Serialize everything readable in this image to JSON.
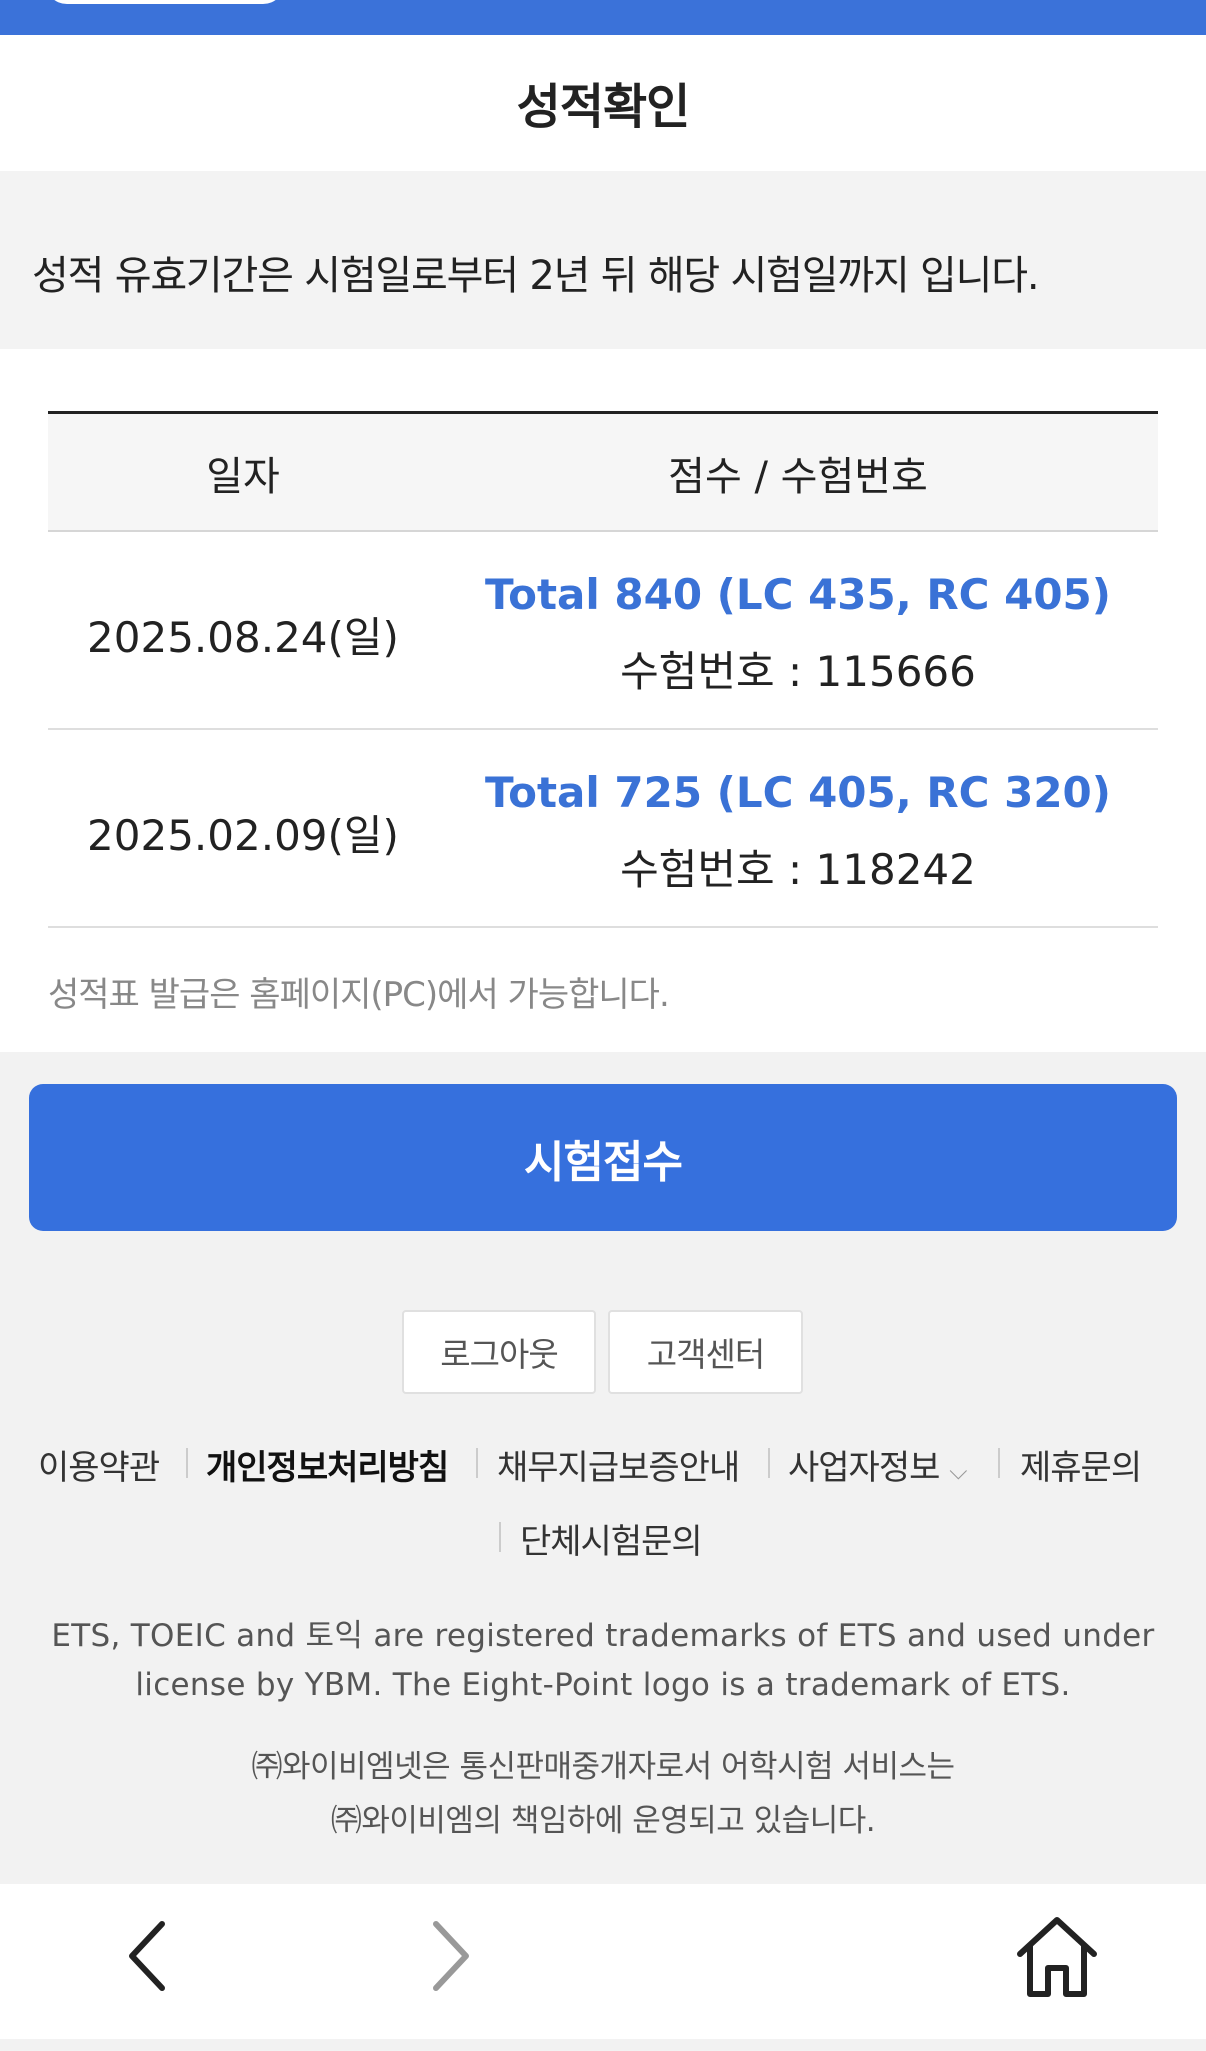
{
  "header": {
    "title": "성적확인"
  },
  "notice": "성적 유효기간은 시험일로부터 2년 뒤 해당 시험일까지 입니다.",
  "table": {
    "columns": [
      "일자",
      "점수 / 수험번호"
    ],
    "rows": [
      {
        "date": "2025.08.24(일)",
        "score": "Total 840 (LC 435, RC 405)",
        "reg": "수험번호 : 115666"
      },
      {
        "date": "2025.02.09(일)",
        "score": "Total 725 (LC 405, RC 320)",
        "reg": "수험번호 : 118242"
      }
    ]
  },
  "note": "성적표 발급은 홈페이지(PC)에서 가능합니다.",
  "apply_button": "시험접수",
  "logout_button": "로그아웃",
  "customer_center_button": "고객센터",
  "footer_links": {
    "terms": "이용약관",
    "privacy": "개인정보처리방침",
    "guarantee": "채무지급보증안내",
    "business": "사업자정보",
    "partnership": "제휴문의",
    "group_test": "단체시험문의"
  },
  "legal": {
    "trademark_line1": "ETS, TOEIC and 토익 are registered trademarks of ETS and used under",
    "trademark_line2": "license by YBM. The Eight-Point logo is a trademark of ETS.",
    "company_line1": "㈜와이비엠넷은 통신판매중개자로서 어학시험 서비스는",
    "company_line2": "㈜와이비엠의 책임하에 운영되고 있습니다."
  },
  "colors": {
    "primary": "#3670dd",
    "score_text": "#3a72d6"
  },
  "icons": [
    "back-icon",
    "forward-icon",
    "home-icon",
    "chevron-down-icon"
  ]
}
